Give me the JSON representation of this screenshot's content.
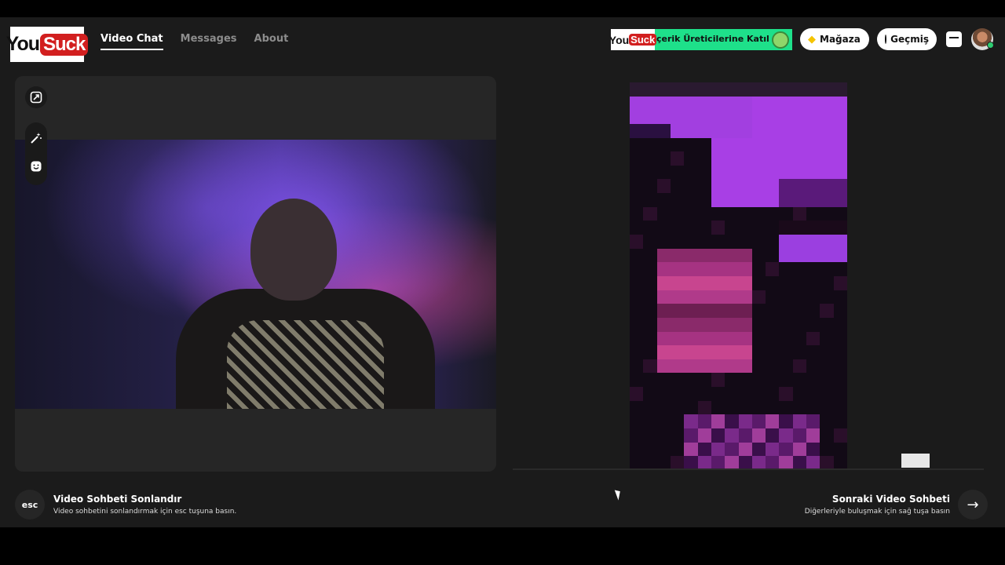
{
  "header": {
    "logo": {
      "part1": "You",
      "part2": "Suck"
    },
    "nav": [
      {
        "label": "Video Chat",
        "active": true
      },
      {
        "label": "Messages",
        "active": false
      },
      {
        "label": "About",
        "active": false
      }
    ],
    "banner": {
      "logo1": "You",
      "logo2": "Suck",
      "text": "çerik Üreticilerine Katıl"
    },
    "store_label": "Mağaza",
    "history_label": "Geçmiş",
    "store_icon": "gem-icon",
    "history_icon": "clock-icon"
  },
  "left_panel": {
    "tools": [
      "expand-icon",
      "magic-wand-icon",
      "face-icon"
    ]
  },
  "footer": {
    "esc_key": "esc",
    "end_title": "Video Sohbeti Sonlandır",
    "end_subtitle": "Video sohbetini sonlandırmak için esc tuşuna basın.",
    "next_title": "Sonraki Video Sohbeti",
    "next_subtitle": "Diğerleriyle buluşmak için sağ tuşa basın",
    "next_icon_glyph": "→"
  },
  "colors": {
    "background": "#1b1b1b",
    "banner": "#1ee08a",
    "brand_red": "#d21f1f",
    "accent_purple": "#a23fe0"
  }
}
